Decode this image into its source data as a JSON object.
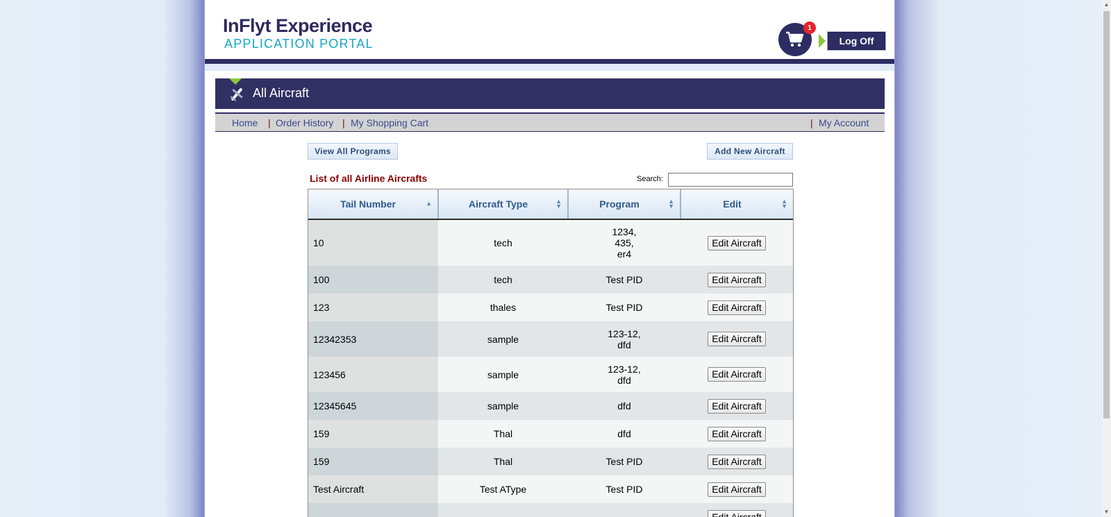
{
  "header": {
    "logo_line1": "InFlyt Experience",
    "logo_line2": "APPLICATION PORTAL",
    "cart_count": "1",
    "logoff_label": "Log Off"
  },
  "title_bar": {
    "title": "All Aircraft"
  },
  "nav": {
    "home": "Home",
    "order_history": "Order History",
    "shopping_cart": "My Shopping Cart",
    "my_account": "My Account",
    "separator": "|"
  },
  "actions": {
    "view_all_programs": "View All Programs",
    "add_new_aircraft": "Add New Aircraft"
  },
  "list": {
    "title": "List of all Airline Aircrafts",
    "search_label": "Search:",
    "search_value": ""
  },
  "table": {
    "columns": [
      "Tail Number",
      "Aircraft Type",
      "Program",
      "Edit"
    ],
    "edit_label": "Edit Aircraft",
    "rows": [
      {
        "tail": "10",
        "type": "tech",
        "program": [
          "1234,",
          "435,",
          "er4"
        ]
      },
      {
        "tail": "100",
        "type": "tech",
        "program": [
          "Test PID"
        ]
      },
      {
        "tail": "123",
        "type": "thales",
        "program": [
          "Test PID"
        ]
      },
      {
        "tail": "12342353",
        "type": "sample",
        "program": [
          "123-12,",
          "dfd"
        ]
      },
      {
        "tail": "123456",
        "type": "sample",
        "program": [
          "123-12,",
          "dfd"
        ]
      },
      {
        "tail": "12345645",
        "type": "sample",
        "program": [
          "dfd"
        ]
      },
      {
        "tail": "159",
        "type": "Thal",
        "program": [
          "dfd"
        ]
      },
      {
        "tail": "159",
        "type": "Thal",
        "program": [
          "Test PID"
        ]
      },
      {
        "tail": "Test Aircraft",
        "type": "Test AType",
        "program": [
          "Test PID"
        ]
      }
    ]
  },
  "colors": {
    "brand_navy": "#2e2d63",
    "brand_teal": "#17a5c6",
    "accent_green": "#8cc63f",
    "badge_red": "#e5262b",
    "list_title": "#8b0000"
  }
}
